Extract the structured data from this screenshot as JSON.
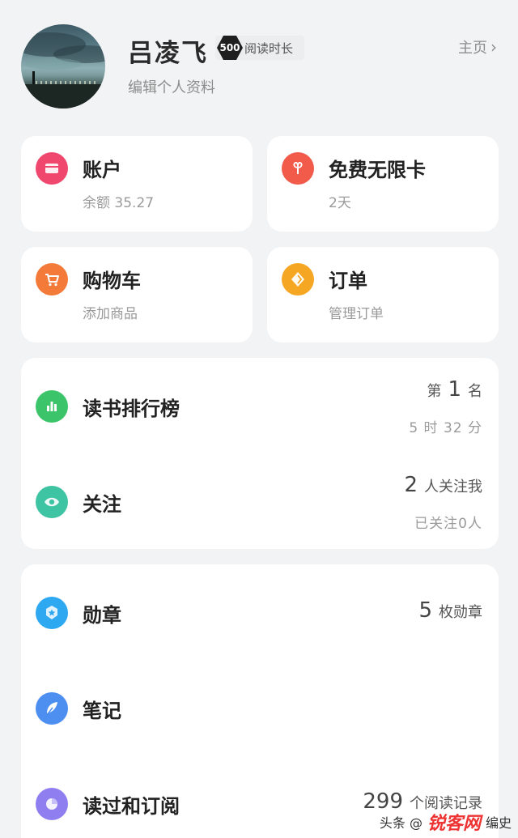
{
  "profile": {
    "name": "吕凌飞",
    "level": "500",
    "level_label": "阅读时长",
    "edit_label": "编辑个人资料",
    "home_label": "主页"
  },
  "cards": {
    "account": {
      "title": "账户",
      "sub": "余额 35.27",
      "color": "#f0476e"
    },
    "free_card": {
      "title": "免费无限卡",
      "sub": "2天",
      "color": "#f25a4a"
    },
    "cart": {
      "title": "购物车",
      "sub": "添加商品",
      "color": "#f47a3a"
    },
    "orders": {
      "title": "订单",
      "sub": "管理订单",
      "color": "#f5a623"
    }
  },
  "list1": {
    "ranking": {
      "title": "读书排行榜",
      "rank_prefix": "第",
      "rank_value": "1",
      "rank_suffix": "名",
      "time": "5 时 32 分",
      "color": "#3cc46a"
    },
    "follow": {
      "title": "关注",
      "count": "2",
      "count_label": "人关注我",
      "following": "已关注0人",
      "color": "#3ec3a3"
    }
  },
  "list2": {
    "medals": {
      "title": "勋章",
      "count": "5",
      "count_label": "枚勋章",
      "color": "#2fa8f2"
    },
    "notes": {
      "title": "笔记",
      "color": "#4c8ff0"
    },
    "read": {
      "title": "读过和订阅",
      "count": "299",
      "count_label": "个阅读记录",
      "color": "#8f7ef0"
    }
  },
  "watermark": {
    "prefix": "头条 @",
    "logo": "锐客网",
    "suffix": "编史"
  }
}
